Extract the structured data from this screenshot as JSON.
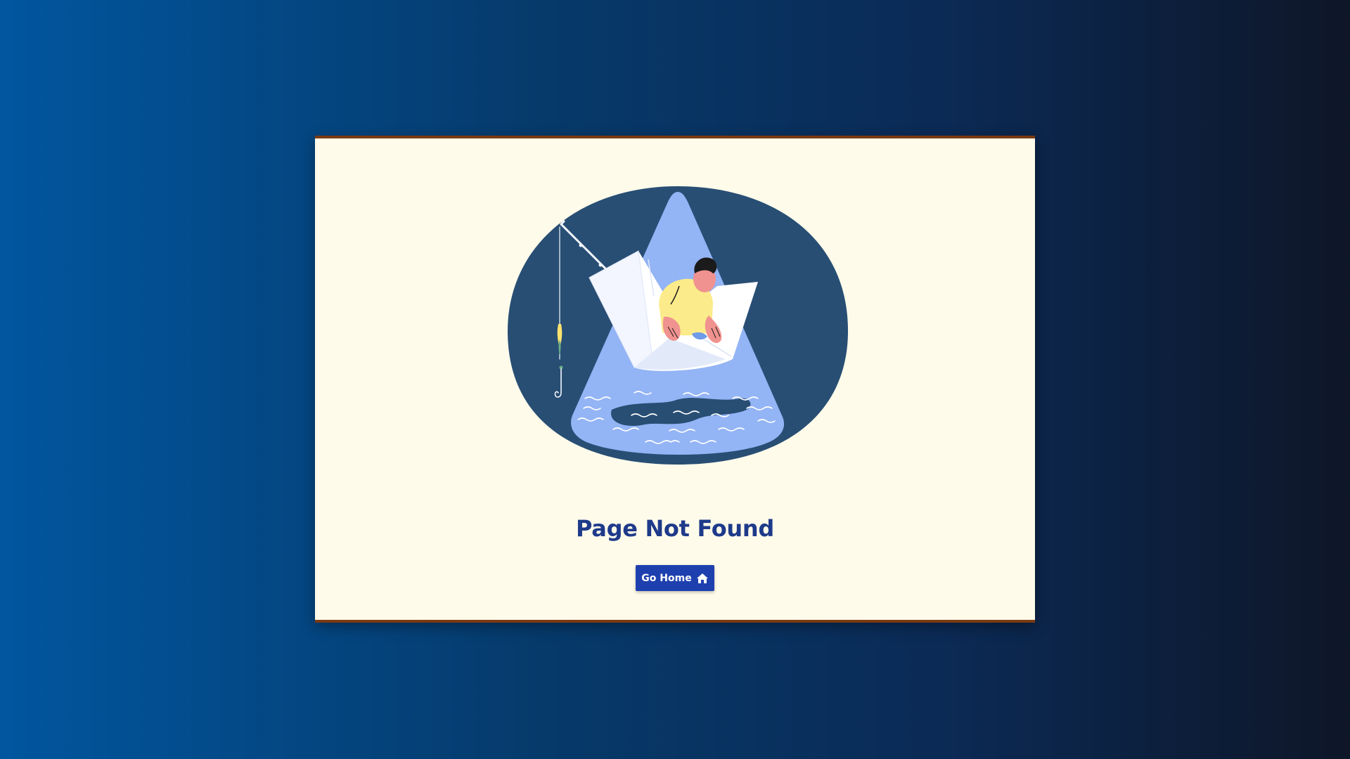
{
  "page": {
    "title": "Page Not Found"
  },
  "actions": {
    "go_home_label": "Go Home",
    "go_home_icon": "home-icon"
  },
  "illustration": {
    "subject": "person-in-paper-boat-fishing",
    "colors": {
      "blob": "#284e74",
      "light_beam": "#93b4f5",
      "shirt": "#fbeb8a",
      "skin": "#f0928f",
      "boat": "#ffffff"
    }
  },
  "theme": {
    "card_background": "#fffbea",
    "card_border": "#7a3a12",
    "title_color": "#1e3a8a",
    "button_color": "#1e40af"
  }
}
